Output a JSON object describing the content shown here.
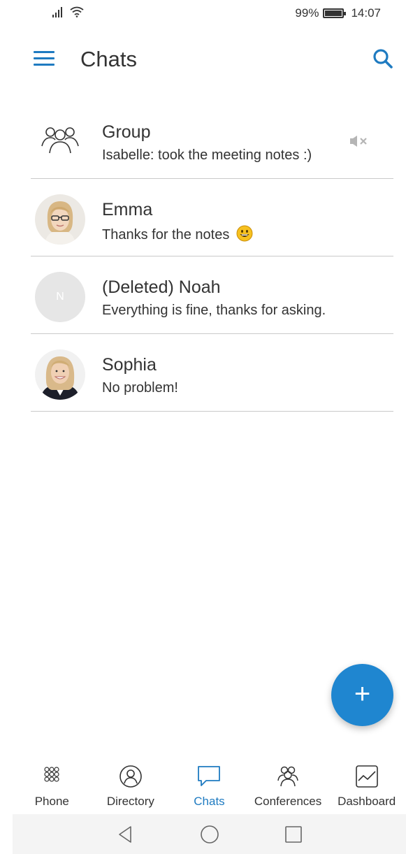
{
  "status_bar": {
    "battery_percent": "99%",
    "time": "14:07",
    "icons": [
      "signal-icon",
      "wifi-icon",
      "battery-icon"
    ]
  },
  "header": {
    "title": "Chats",
    "menu_icon": "menu-icon",
    "search_icon": "search-icon"
  },
  "chats": [
    {
      "name": "Group",
      "message": "Isabelle: took the meeting notes :)",
      "avatar": "group-icon",
      "muted": true
    },
    {
      "name": "Emma",
      "message": "Thanks for the notes",
      "avatar": "photo",
      "emoji": "grinning-face"
    },
    {
      "name": "(Deleted) Noah",
      "message": "Everything is fine, thanks for asking.",
      "avatar_initial": "N"
    },
    {
      "name": "Sophia",
      "message": "No problem!",
      "avatar": "photo"
    }
  ],
  "fab": {
    "label": "+",
    "icon": "plus-icon"
  },
  "bottom_nav": [
    {
      "label": "Phone",
      "icon": "dialpad-icon"
    },
    {
      "label": "Directory",
      "icon": "directory-icon"
    },
    {
      "label": "Chats",
      "icon": "chat-bubble-icon",
      "active": true
    },
    {
      "label": "Conferences",
      "icon": "conferences-icon"
    },
    {
      "label": "Dashboard",
      "icon": "dashboard-icon"
    }
  ],
  "colors": {
    "accent": "#1f7bc1",
    "fab": "#1f86d0",
    "divider": "#c9c9c9"
  }
}
